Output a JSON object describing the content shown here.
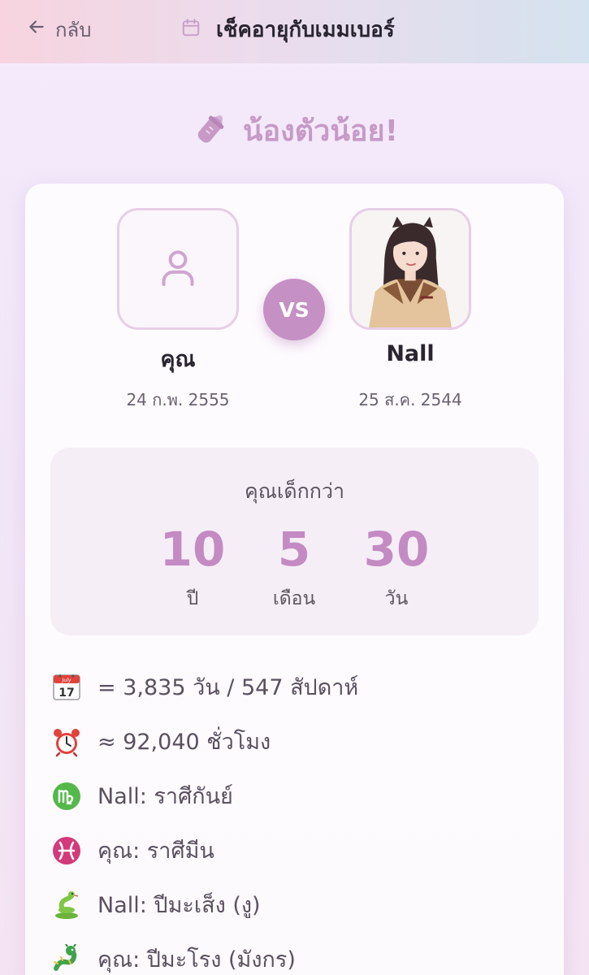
{
  "header": {
    "back_label": "กลับ",
    "title": "เช็คอายุกับเมมเบอร์"
  },
  "hero": {
    "headline": "น้องตัวน้อย!"
  },
  "comparison": {
    "vs_label": "VS",
    "you": {
      "name": "คุณ",
      "birthday": "24 ก.พ. 2555"
    },
    "member": {
      "name": "Nall",
      "birthday": "25 ส.ค. 2544"
    }
  },
  "difference": {
    "caption": "คุณเด็กกว่า",
    "years": "10",
    "years_unit": "ปี",
    "months": "5",
    "months_unit": "เดือน",
    "days": "30",
    "days_unit": "วัน"
  },
  "facts": [
    {
      "icon": "calendar-icon",
      "text": "= 3,835 วัน / 547 สัปดาห์"
    },
    {
      "icon": "alarm-clock-icon",
      "text": "≈ 92,040 ชั่วโมง"
    },
    {
      "icon": "virgo-icon",
      "text": "Nall: ราศีกันย์"
    },
    {
      "icon": "pisces-icon",
      "text": "คุณ: ราศีมีน"
    },
    {
      "icon": "snake-icon",
      "text": "Nall: ปีมะเส็ง (งู)"
    },
    {
      "icon": "dragon-icon",
      "text": "คุณ: ปีมะโรง (มังกร)"
    }
  ],
  "colors": {
    "accent": "#c590c4",
    "number": "#c48ac3",
    "avatar_border": "#e6cfe6"
  }
}
